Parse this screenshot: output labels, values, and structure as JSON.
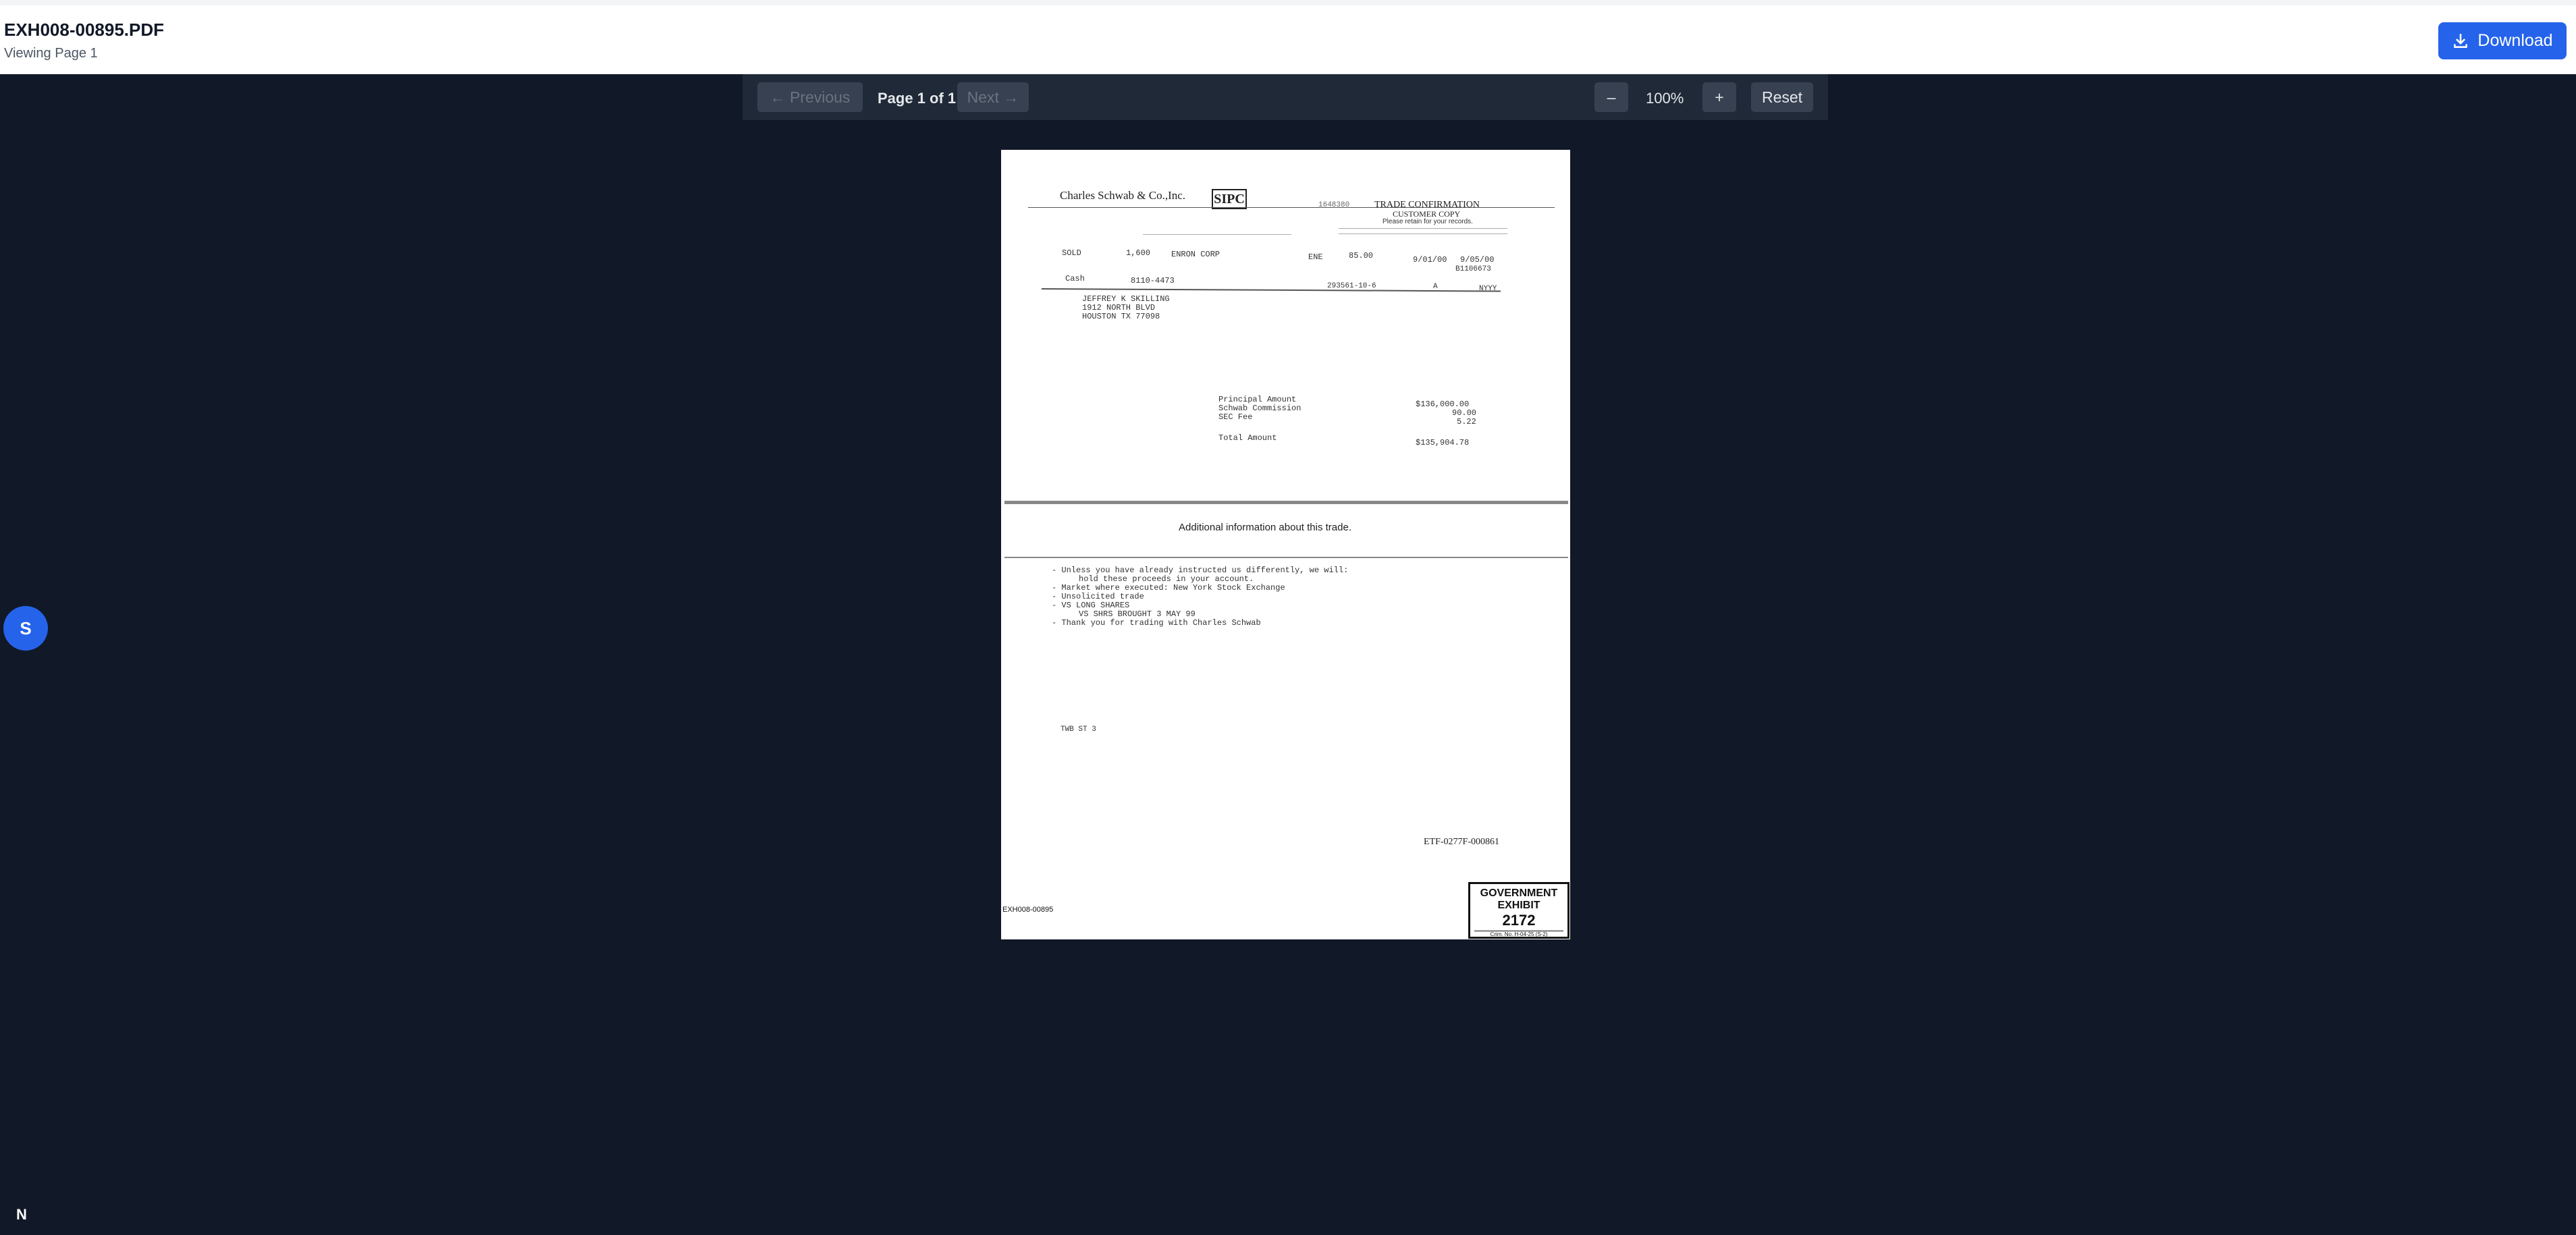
{
  "header": {
    "title": "EXH008-00895.PDF",
    "subtitle": "Viewing Page 1",
    "download_label": "Download"
  },
  "toolbar": {
    "previous_label": "← Previous",
    "page_indicator": "Page 1 of 1",
    "next_label": "Next →",
    "zoom_out_label": "–",
    "zoom_level": "100%",
    "zoom_in_label": "+",
    "reset_label": "Reset"
  },
  "document": {
    "company": "Charles Schwab & Co.,Inc.",
    "sipc": "SIPC",
    "ref_no": "1648380",
    "heading": "TRADE CONFIRMATION",
    "copy": "CUSTOMER COPY",
    "retain": "Please retain for your records.",
    "action": "SOLD",
    "quantity": "1,600",
    "description": "ENRON CORP",
    "symbol": "ENE",
    "price": "85.00",
    "trade_date": "9/01/00",
    "settle_date": "9/05/00",
    "ref_code": "B1106673",
    "account_type": "Cash",
    "account_number": "8110-4473",
    "cusip": "293561-10-6",
    "capacity": "A",
    "code": "NYYY",
    "address_1": "JEFFREY K SKILLING",
    "address_2": "1912 NORTH BLVD",
    "address_3": "HOUSTON TX  77098",
    "principal_label": "Principal Amount",
    "principal_value": "$136,000.00",
    "commission_label": "Schwab Commission",
    "commission_value": "90.00",
    "sec_fee_label": "SEC Fee",
    "sec_fee_value": "5.22",
    "total_label": "Total Amount",
    "total_value": "$135,904.78",
    "additional_info": "Additional information about this trade.",
    "note_1": "- Unless you have already instructed us differently, we will:",
    "note_1b": "hold these proceeds in your account.",
    "note_2": "- Market where executed:  New York Stock Exchange",
    "note_3": "- Unsolicited trade",
    "note_4": "- VS LONG SHARES",
    "note_4b": "VS SHRS BROUGHT 3 MAY 99",
    "note_5": "- Thank you for trading with Charles Schwab",
    "footer_code": "TWB ST 3",
    "etf_code": "ETF-0277F-000861",
    "exhibit_code": "EXH008-00895",
    "stamp_line_1": "GOVERNMENT",
    "stamp_line_2": "EXHIBIT",
    "stamp_number": "2172",
    "stamp_case": "Crim. No. H-04-25 (S-2)"
  },
  "sidebar": {
    "avatar_initial": "S",
    "logo": "N"
  }
}
